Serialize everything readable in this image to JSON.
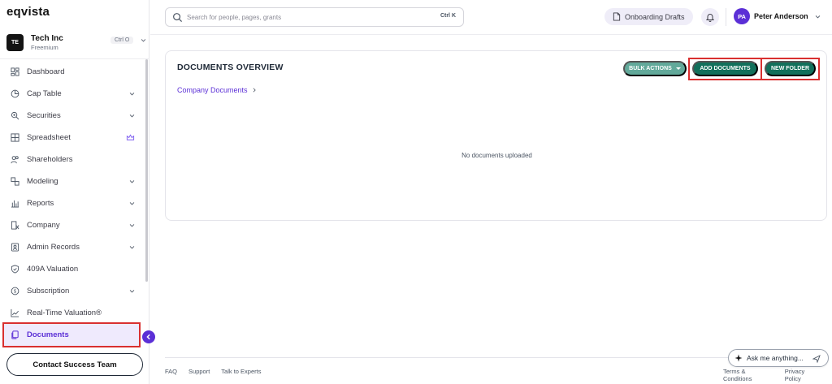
{
  "app": {
    "logo": "eqvista"
  },
  "company": {
    "initials": "TE",
    "name": "Tech Inc",
    "plan": "Freemium",
    "shortcut": "Ctrl O"
  },
  "sidebar": {
    "items": [
      {
        "label": "Dashboard",
        "icon": "dashboard-icon",
        "has_caret": false
      },
      {
        "label": "Cap Table",
        "icon": "pie-chart-icon",
        "has_caret": true
      },
      {
        "label": "Securities",
        "icon": "securities-icon",
        "has_caret": true
      },
      {
        "label": "Spreadsheet",
        "icon": "grid-icon",
        "has_caret": false,
        "badge": "crown-icon"
      },
      {
        "label": "Shareholders",
        "icon": "users-icon",
        "has_caret": false
      },
      {
        "label": "Modeling",
        "icon": "modeling-icon",
        "has_caret": true
      },
      {
        "label": "Reports",
        "icon": "reports-icon",
        "has_caret": true
      },
      {
        "label": "Company",
        "icon": "company-icon",
        "has_caret": true
      },
      {
        "label": "Admin Records",
        "icon": "admin-icon",
        "has_caret": true
      },
      {
        "label": "409A Valuation",
        "icon": "shield-check-icon",
        "has_caret": false
      },
      {
        "label": "Subscription",
        "icon": "subscription-icon",
        "has_caret": true
      },
      {
        "label": "Real-Time Valuation®",
        "icon": "trend-icon",
        "has_caret": false
      },
      {
        "label": "Documents",
        "icon": "documents-icon",
        "has_caret": false,
        "active": true
      }
    ],
    "contact_button": "Contact Success Team"
  },
  "header": {
    "search_placeholder": "Search for people, pages, grants",
    "search_shortcut": "Ctrl K",
    "drafts_label": "Onboarding Drafts",
    "user_initials": "PA",
    "user_name": "Peter Anderson"
  },
  "main": {
    "title": "DOCUMENTS OVERVIEW",
    "bulk_actions": "BULK ACTIONS",
    "add_documents": "ADD DOCUMENTS",
    "new_folder": "NEW FOLDER",
    "breadcrumb": "Company Documents",
    "empty_message": "No documents uploaded"
  },
  "footer": {
    "links": [
      "FAQ",
      "Support",
      "Talk to Experts"
    ],
    "right_links": [
      "Terms & Conditions",
      "Privacy Policy"
    ]
  },
  "assistant": {
    "placeholder": "Ask me anything..."
  },
  "colors": {
    "brand_purple": "#5b2fd6",
    "primary_green": "#12705b",
    "bulk_green": "#62a99a",
    "highlight_red": "#d93030"
  }
}
